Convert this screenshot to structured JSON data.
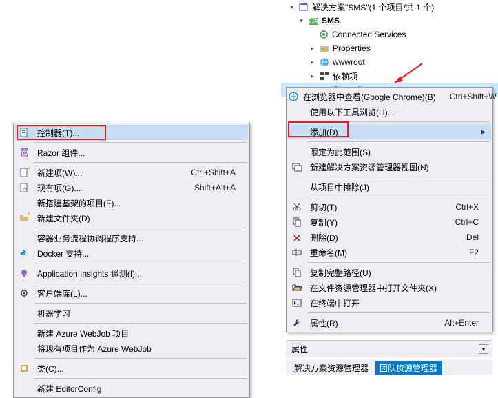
{
  "tree": {
    "solution_label": "解决方案\"SMS\"(1 个项目/共 1 个)",
    "project": "SMS",
    "items": {
      "connected": "Connected Services",
      "properties": "Properties",
      "wwwroot": "wwwroot",
      "deps": "依赖项",
      "controllers": "Controllers"
    }
  },
  "menuRight": {
    "view_browser": "在浏览器中查看(Google Chrome)(B)",
    "view_browser_key": "Ctrl+Shift+W",
    "browse_with": "使用以下工具浏览(H)...",
    "add": "添加(D)",
    "scope": "限定为此范围(S)",
    "new_sol_view": "新建解决方案资源管理器视图(N)",
    "exclude": "从项目中排除(J)",
    "cut": "剪切(T)",
    "cut_key": "Ctrl+X",
    "copy": "复制(Y)",
    "copy_key": "Ctrl+C",
    "delete": "删除(D)",
    "delete_key": "Del",
    "rename": "重命名(M)",
    "rename_key": "F2",
    "copypath": "复制完整路径(U)",
    "openfolder": "在文件资源管理器中打开文件夹(X)",
    "terminal": "在终端中打开",
    "properties": "属性(R)",
    "properties_key": "Alt+Enter"
  },
  "menuLeft": {
    "controller": "控制器(T)...",
    "razor": "Razor 组件...",
    "new_item": "新建项(W)...",
    "new_item_key": "Ctrl+Shift+A",
    "existing_item": "现有项(G)...",
    "existing_item_key": "Shift+Alt+A",
    "scaffold": "新搭建基架的项目(F)...",
    "new_folder": "新建文件夹(D)",
    "container": "容器业务流程协调程序支持...",
    "docker": "Docker 支持...",
    "appinsights": "Application Insights 遥测(I)...",
    "clientlib": "客户端库(L)...",
    "ml": "机器学习",
    "webjob_new": "新建 Azure WebJob 项目",
    "webjob_existing": "将现有项目作为 Azure WebJob",
    "class": "类(C)...",
    "editorconfig": "新建 EditorConfig"
  },
  "bottom": {
    "prop_title": "属性",
    "tab1": "解决方案资源管理器",
    "tab2": "团队资源管理器"
  }
}
